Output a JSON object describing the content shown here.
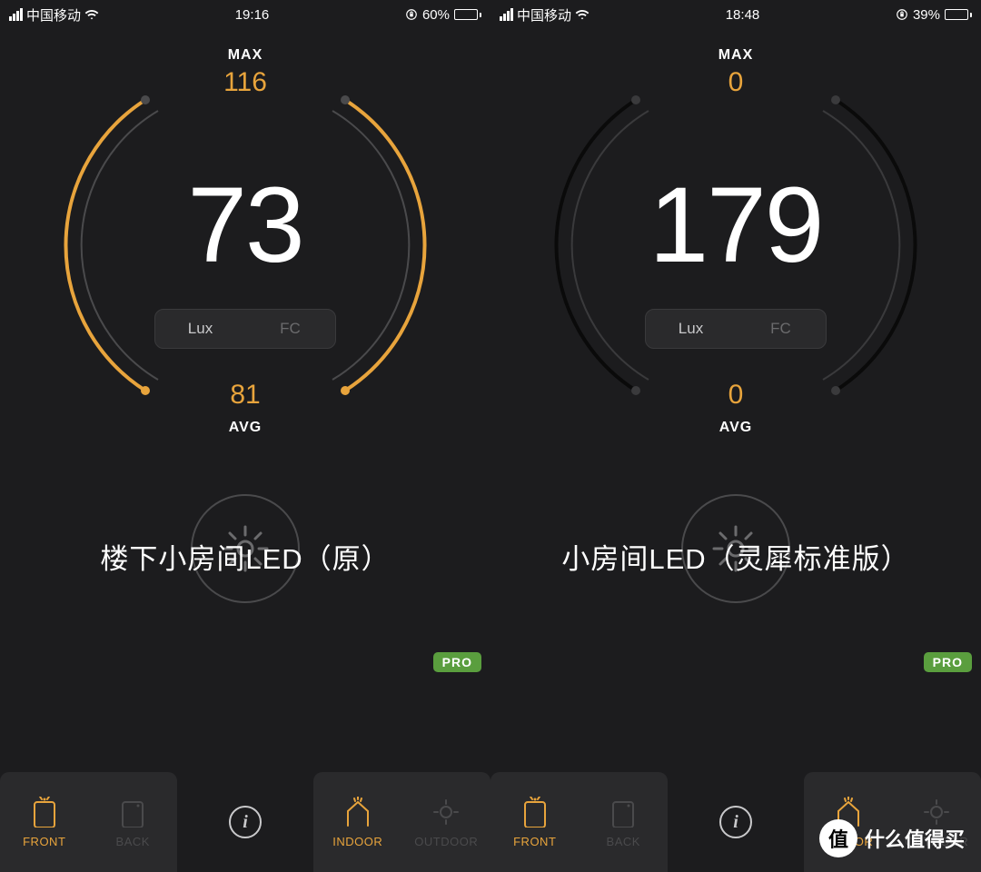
{
  "screens": [
    {
      "status": {
        "carrier": "中国移动",
        "time": "19:16",
        "battery_pct": "60%",
        "battery_fill": 60
      },
      "gauge": {
        "max_label": "MAX",
        "max_val": "116",
        "reading": "73",
        "avg_val": "81",
        "avg_label": "AVG",
        "arc_color": "#e8a43c"
      },
      "unit": {
        "lux": "Lux",
        "fc": "FC",
        "active": "lux"
      },
      "caption": "楼下小房间LED（原）",
      "pro": "PRO",
      "tabs": {
        "front": "FRONT",
        "back": "BACK",
        "indoor": "INDOOR",
        "outdoor": "OUTDOOR"
      }
    },
    {
      "status": {
        "carrier": "中国移动",
        "time": "18:48",
        "battery_pct": "39%",
        "battery_fill": 39
      },
      "gauge": {
        "max_label": "MAX",
        "max_val": "0",
        "reading": "179",
        "avg_val": "0",
        "avg_label": "AVG",
        "arc_color": "#0a0a0a"
      },
      "unit": {
        "lux": "Lux",
        "fc": "FC",
        "active": "lux"
      },
      "caption": "小房间LED（灵犀标准版）",
      "pro": "PRO",
      "tabs": {
        "front": "FRONT",
        "back": "BACK",
        "indoor": "INDOOR",
        "outdoor": "OUTDOOR"
      }
    }
  ],
  "watermark": {
    "badge": "值",
    "text": "什么值得买"
  }
}
